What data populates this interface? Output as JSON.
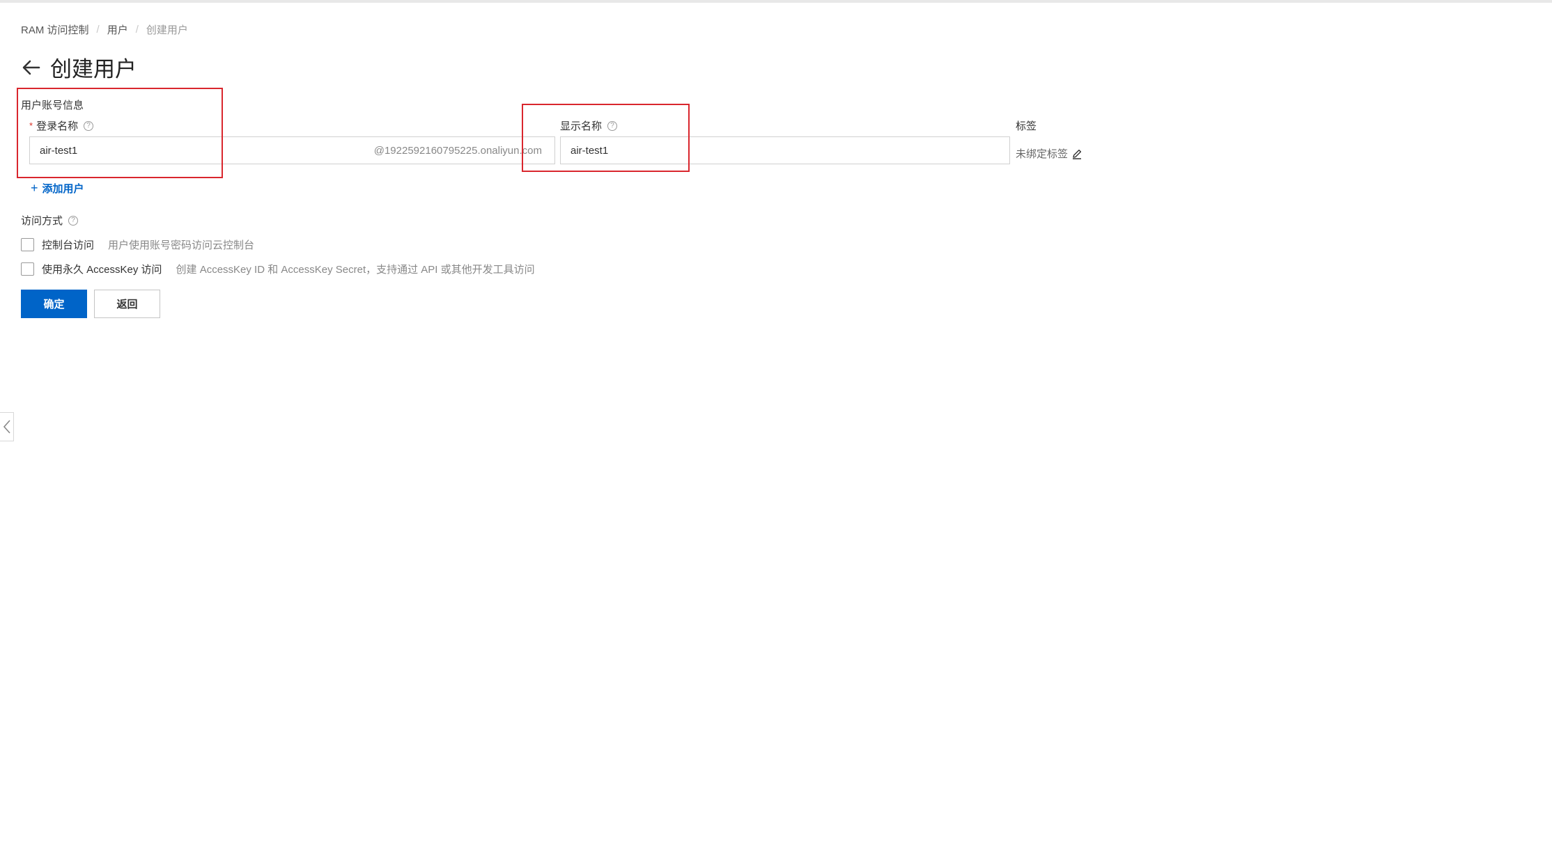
{
  "breadcrumb": {
    "items": [
      "RAM 访问控制",
      "用户",
      "创建用户"
    ]
  },
  "page": {
    "title": "创建用户"
  },
  "form": {
    "section_label": "用户账号信息",
    "login_name": {
      "label": "登录名称",
      "value": "air-test1",
      "suffix": "@1922592160795225.onaliyun.com"
    },
    "display_name": {
      "label": "显示名称",
      "value": "air-test1"
    },
    "tags": {
      "label": "标签",
      "value": "未绑定标签"
    },
    "add_user_label": "添加用户",
    "access": {
      "label": "访问方式",
      "options": [
        {
          "label": "控制台访问",
          "description": "用户使用账号密码访问云控制台",
          "checked": false
        },
        {
          "label": "使用永久 AccessKey 访问",
          "description": "创建 AccessKey ID 和 AccessKey Secret，支持通过 API 或其他开发工具访问",
          "checked": false
        }
      ]
    }
  },
  "actions": {
    "confirm_label": "确定",
    "back_label": "返回"
  },
  "colors": {
    "primary": "#0064c8",
    "required": "#d93026",
    "highlight": "#d9262d"
  }
}
